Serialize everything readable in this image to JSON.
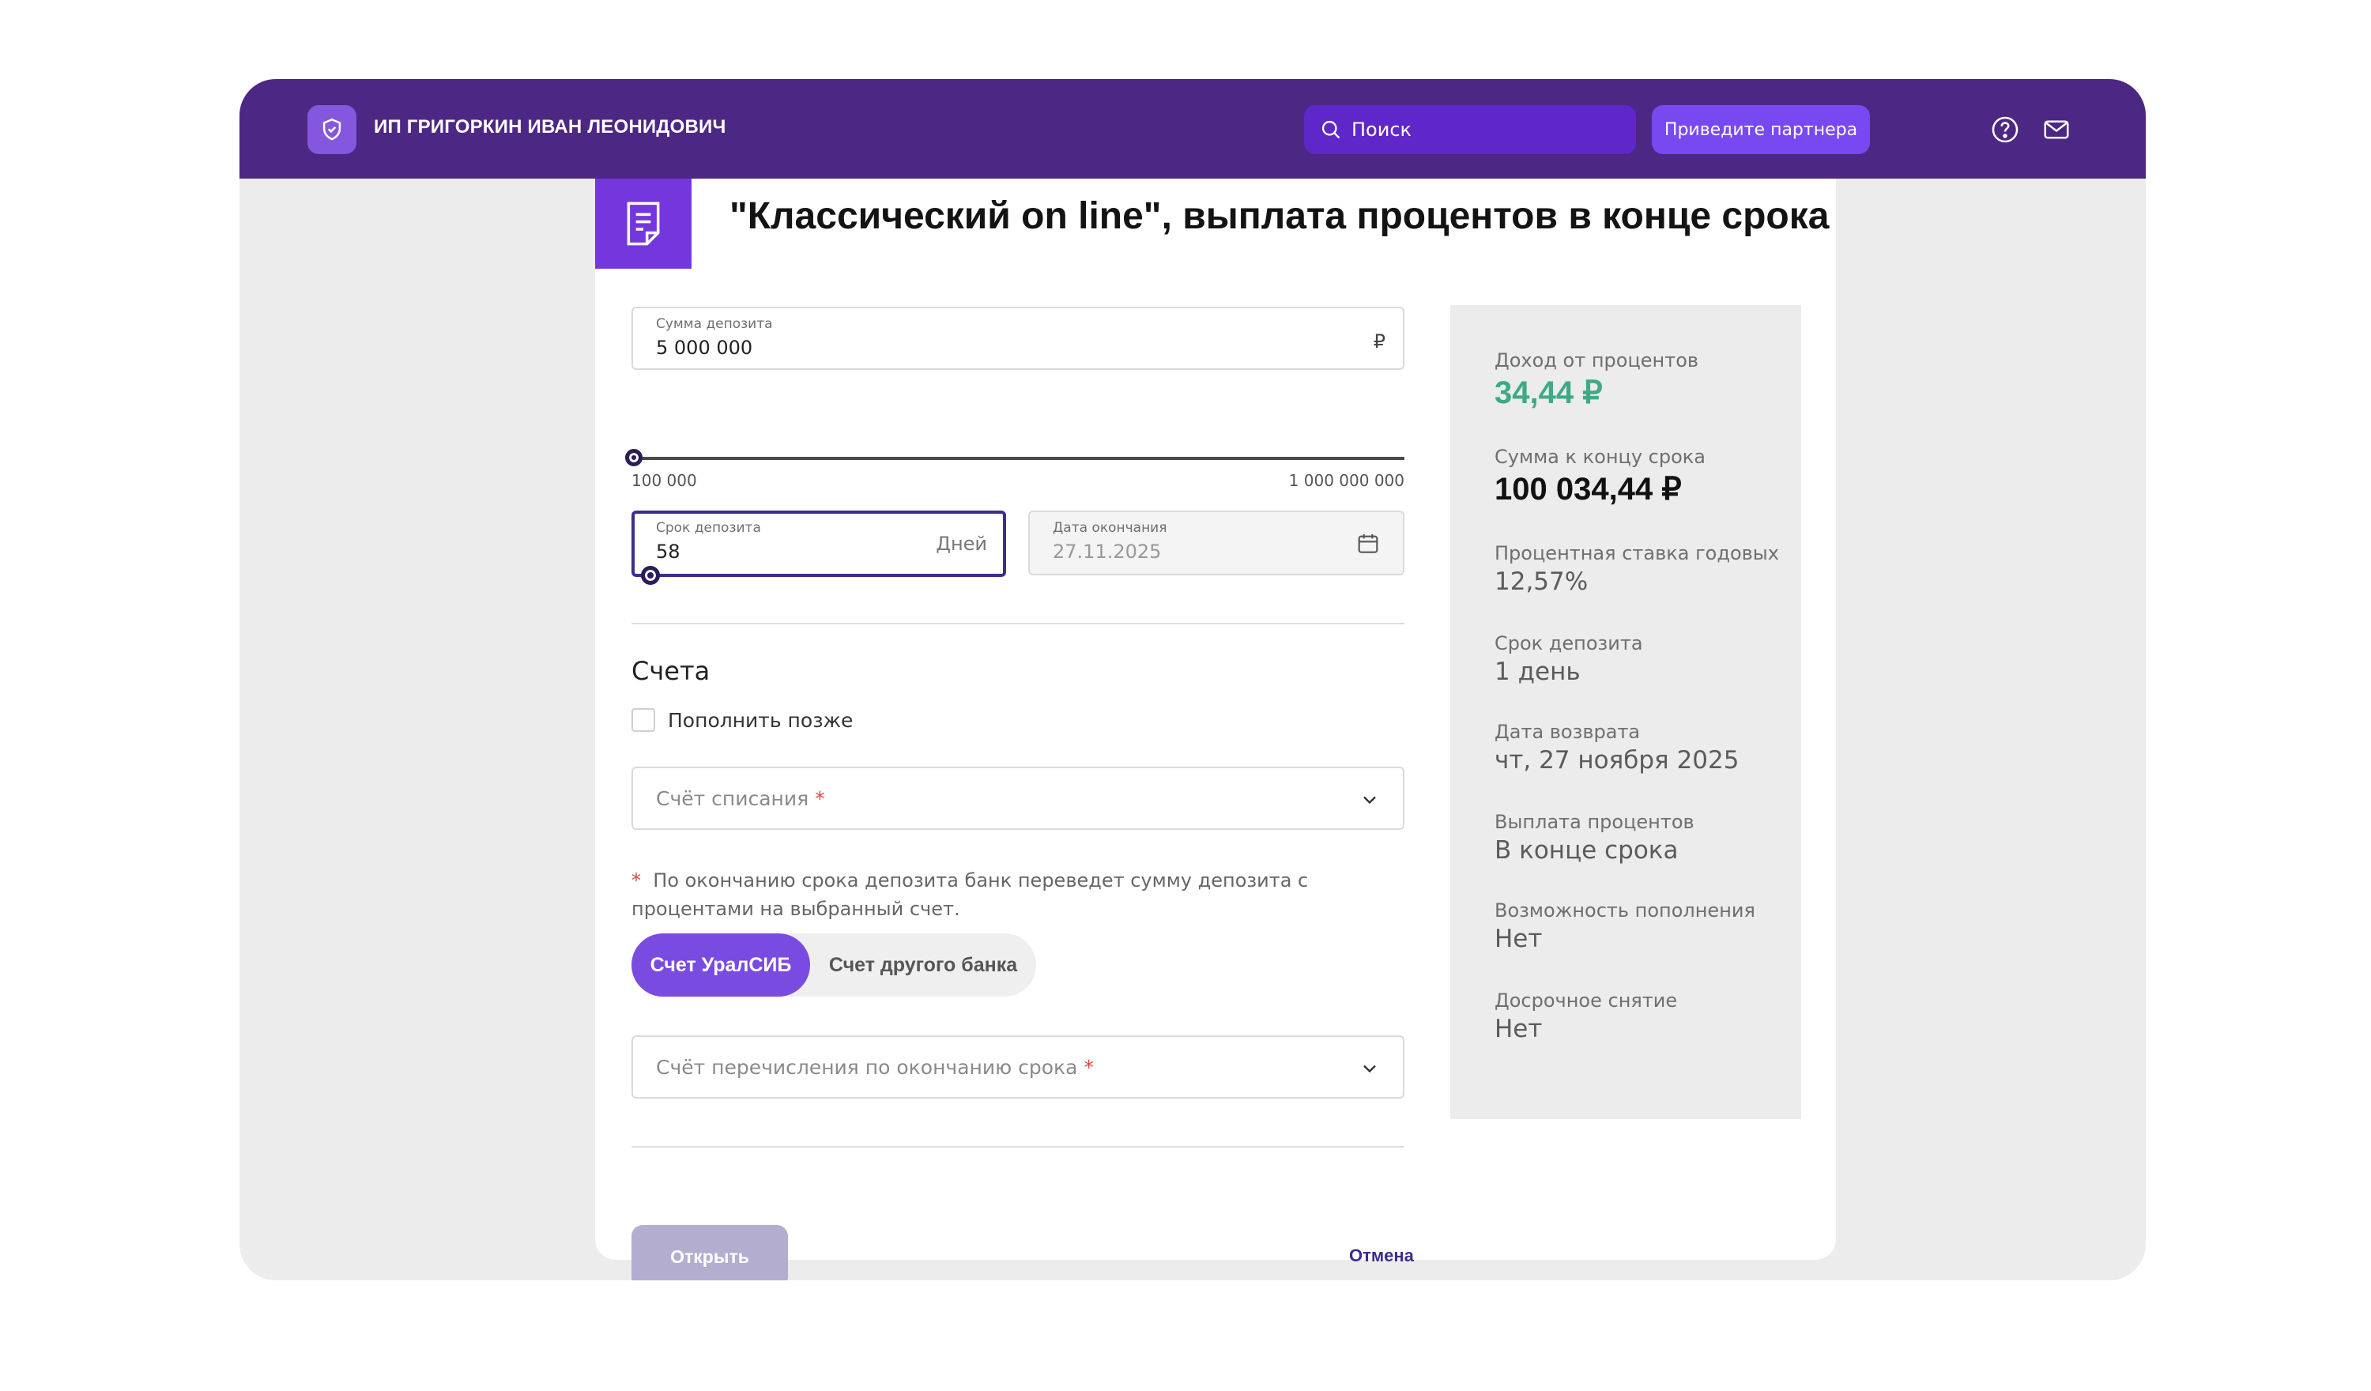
{
  "header": {
    "company": "ИП ГРИГОРКИН ИВАН ЛЕОНИДОВИЧ",
    "search_placeholder": "Поиск",
    "partner_button": "Приведите партнера"
  },
  "page": {
    "title": "\"Классический on line\", выплата процентов в конце срока"
  },
  "form": {
    "amount": {
      "label": "Сумма депозита",
      "value": "5 000 000",
      "currency": "₽",
      "min_label": "100 000",
      "max_label": "1 000 000 000"
    },
    "term": {
      "label": "Срок депозита",
      "value": "58",
      "unit": "Дней"
    },
    "end_date": {
      "label": "Дата окончания",
      "value": "27.11.2025"
    },
    "accounts": {
      "title": "Счета",
      "topup_later": "Пополнить позже",
      "debit_placeholder": "Счёт списания",
      "required_mark": "*",
      "note": "По окончанию срока депозита банк переведет сумму депозита с процентами на выбранный счет.",
      "toggle": {
        "option1": "Счет УралСИБ",
        "option2": "Счет другого банка"
      },
      "credit_placeholder": "Счёт перечисления по окончанию срока"
    },
    "open_button": "Открыть",
    "cancel_link": "Отмена"
  },
  "summary": {
    "income_label": "Доход от процентов",
    "income_value": "34,44 ₽",
    "total_label": "Сумма к концу срока",
    "total_value": "100 034,44 ₽",
    "rate_label": "Процентная ставка годовых",
    "rate_value": "12,57%",
    "term_label": "Срок депозита",
    "term_value": "1 день",
    "return_label": "Дата возврата",
    "return_value": "чт, 27 ноября 2025",
    "payout_label": "Выплата процентов",
    "payout_value": "В конце срока",
    "topup_label": "Возможность пополнения",
    "topup_value": "Нет",
    "withdraw_label": "Досрочное снятие",
    "withdraw_value": "Нет"
  },
  "colors": {
    "header_bg": "#4d2784",
    "accent": "#7a4be0",
    "income_green": "#3eaa86"
  }
}
